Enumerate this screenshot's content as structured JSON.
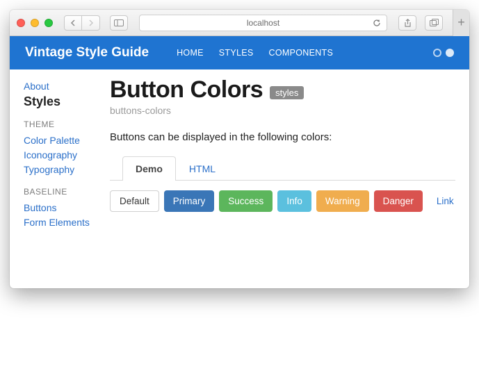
{
  "browser": {
    "url": "localhost"
  },
  "nav": {
    "brand": "Vintage Style Guide",
    "items": [
      "HOME",
      "STYLES",
      "COMPONENTS"
    ]
  },
  "sidebar": {
    "about": "About",
    "current": "Styles",
    "sections": [
      {
        "heading": "THEME",
        "items": [
          "Color Palette",
          "Iconography",
          "Typography"
        ]
      },
      {
        "heading": "BASELINE",
        "items": [
          "Buttons",
          "Form Elements"
        ]
      }
    ]
  },
  "page": {
    "title": "Button Colors",
    "badge": "styles",
    "slug": "buttons-colors",
    "intro": "Buttons can be displayed in the following colors:",
    "tabs": [
      "Demo",
      "HTML"
    ],
    "active_tab": 0,
    "buttons": [
      {
        "label": "Default",
        "variant": "default"
      },
      {
        "label": "Primary",
        "variant": "primary"
      },
      {
        "label": "Success",
        "variant": "success"
      },
      {
        "label": "Info",
        "variant": "info"
      },
      {
        "label": "Warning",
        "variant": "warning"
      },
      {
        "label": "Danger",
        "variant": "danger"
      },
      {
        "label": "Link",
        "variant": "link"
      }
    ]
  }
}
